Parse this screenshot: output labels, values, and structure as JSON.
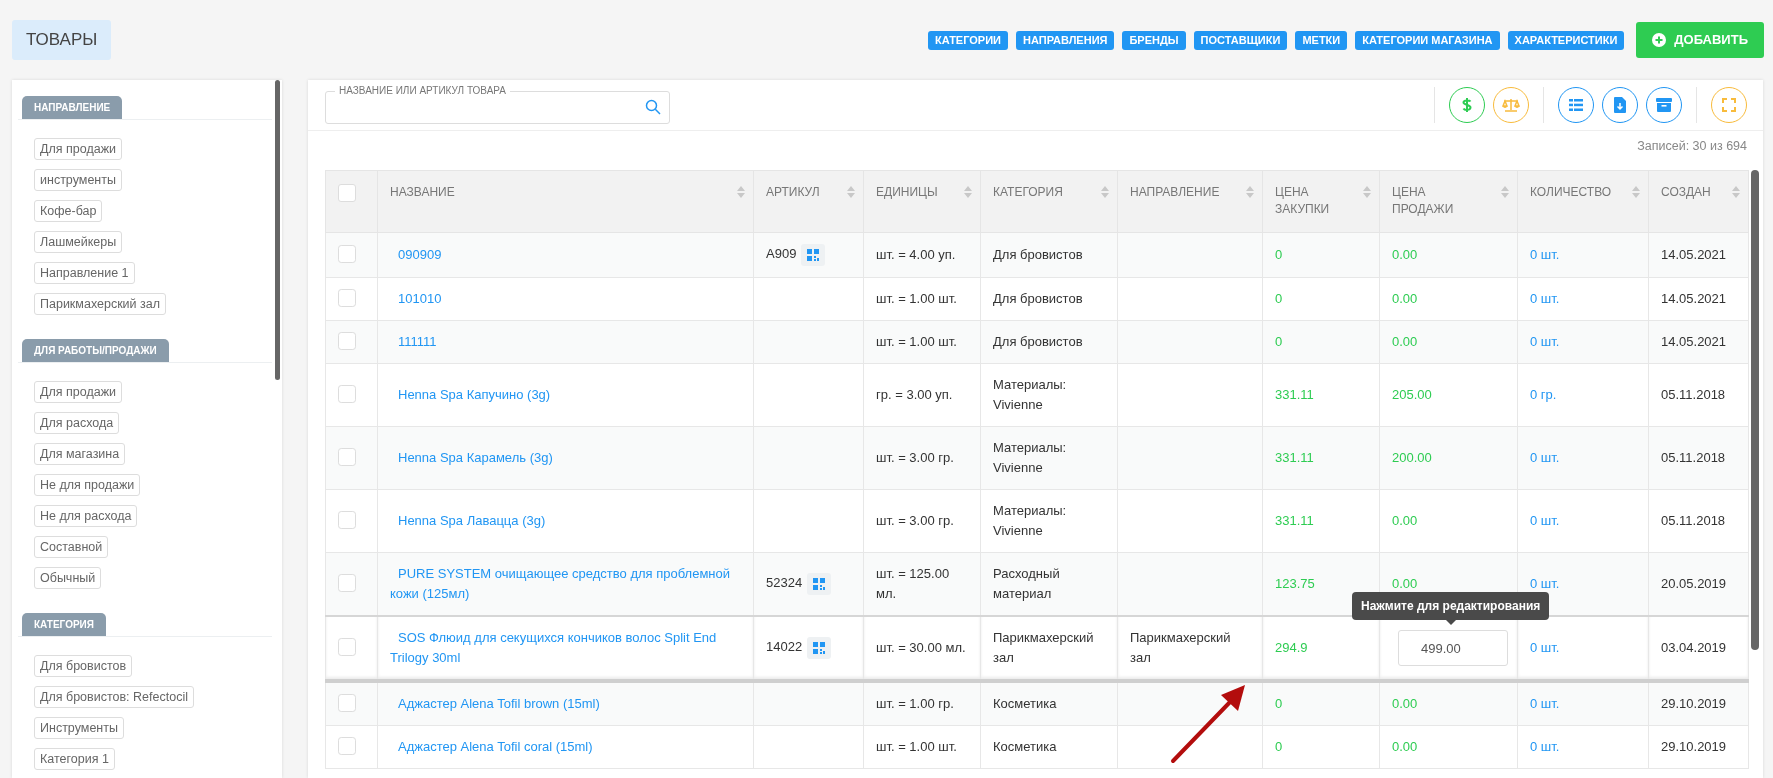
{
  "page": {
    "title": "ТОВАРЫ"
  },
  "header_buttons": [
    "КАТЕГОРИИ",
    "НАПРАВЛЕНИЯ",
    "БРЕНДЫ",
    "ПОСТАВЩИКИ",
    "МЕТКИ",
    "КАТЕГОРИИ МАГАЗИНА",
    "ХАРАКТЕРИСТИКИ"
  ],
  "add_button": {
    "label": "ДОБАВИТЬ"
  },
  "sidebar": {
    "sections": [
      {
        "title": "НАПРАВЛЕНИЕ",
        "items": [
          "Для продажи",
          "инструменты",
          "Кофе-бар",
          "Лашмейкеры",
          "Направление 1",
          "Парикмахерский зал"
        ]
      },
      {
        "title": "ДЛЯ РАБОТЫ/ПРОДАЖИ",
        "items": [
          "Для продажи",
          "Для расхода",
          "Для магазина",
          "Не для продажи",
          "Не для расхода",
          "Составной",
          "Обычный"
        ]
      },
      {
        "title": "КАТЕГОРИЯ",
        "items": [
          "Для бровистов",
          "Для бровистов: Refectocil",
          "Инструменты",
          "Категория 1"
        ]
      }
    ]
  },
  "search": {
    "label": "НАЗВАНИЕ ИЛИ АРТИКУЛ ТОВАРА"
  },
  "records": "Записей: 30 из 694",
  "table": {
    "select_all": {
      "checked": false
    },
    "columns": [
      "НАЗВАНИЕ",
      "АРТИКУЛ",
      "ЕДИНИЦЫ",
      "КАТЕГОРИЯ",
      "НАПРАВЛЕНИЕ",
      "ЦЕНА ЗАКУПКИ",
      "ЦЕНА ПРОДАЖИ",
      "КОЛИЧЕСТВО",
      "СОЗДАН"
    ],
    "rows": [
      {
        "checked": false,
        "highlighted": false,
        "editing": false,
        "name": "090909",
        "article": "A909",
        "units": "шт. = 4.00 уп.",
        "category": "Для бровистов",
        "purchase_price": "0",
        "sale_price": "0.00",
        "quantity": "0 шт.",
        "created": "14.05.2021"
      },
      {
        "checked": false,
        "highlighted": false,
        "editing": false,
        "name": "101010",
        "units": "шт. = 1.00 шт.",
        "category": "Для бровистов",
        "purchase_price": "0",
        "sale_price": "0.00",
        "quantity": "0 шт.",
        "created": "14.05.2021"
      },
      {
        "checked": false,
        "highlighted": false,
        "editing": false,
        "name": "111111",
        "units": "шт. = 1.00 шт.",
        "category": "Для бровистов",
        "purchase_price": "0",
        "sale_price": "0.00",
        "quantity": "0 шт.",
        "created": "14.05.2021"
      },
      {
        "checked": false,
        "highlighted": false,
        "editing": false,
        "name": "Henna Spa Капучино (3g)",
        "units": "гр. = 3.00 уп.",
        "category": "Материалы: Vivienne",
        "purchase_price": "331.11",
        "sale_price": "205.00",
        "quantity": "0 гр.",
        "created": "05.11.2018"
      },
      {
        "checked": false,
        "highlighted": false,
        "editing": false,
        "name": "Henna Spa Карамель (3g)",
        "units": "шт. = 3.00 гр.",
        "category": "Материалы: Vivienne",
        "purchase_price": "331.11",
        "sale_price": "200.00",
        "quantity": "0 шт.",
        "created": "05.11.2018"
      },
      {
        "checked": false,
        "highlighted": false,
        "editing": false,
        "name": "Henna Spa Лавацца (3g)",
        "units": "шт. = 3.00 гр.",
        "category": "Материалы: Vivienne",
        "purchase_price": "331.11",
        "sale_price": "0.00",
        "quantity": "0 шт.",
        "created": "05.11.2018"
      },
      {
        "checked": false,
        "highlighted": false,
        "editing": false,
        "name": "PURE SYSTEM очищающее средство для проблемной кожи (125мл)",
        "article": "52324",
        "units": "шт. = 125.00 мл.",
        "category": "Расходный материал",
        "purchase_price": "123.75",
        "sale_price": "0.00",
        "quantity": "0 шт.",
        "created": "20.05.2019"
      },
      {
        "checked": false,
        "highlighted": true,
        "editing": true,
        "tooltip": "Нажмите для редактирования",
        "name": "SOS Флюид для секущихся кончиков волос Split End Trilogy 30ml",
        "article": "14022",
        "units": "шт. = 30.00 мл.",
        "category": "Парикмахерский зал",
        "direction": "Парикмахерский зал",
        "purchase_price": "294.9",
        "sale_price": "499.00",
        "quantity": "0 шт.",
        "created": "03.04.2019"
      },
      {
        "checked": false,
        "highlighted": false,
        "editing": false,
        "name": "Аджастер Alena Tofil brown (15ml)",
        "units": "шт. = 1.00 гр.",
        "category": "Косметика",
        "purchase_price": "0",
        "sale_price": "0.00",
        "quantity": "0 шт.",
        "created": "29.10.2019"
      },
      {
        "checked": false,
        "highlighted": false,
        "editing": false,
        "name": "Аджастер Alena Tofil coral (15ml)",
        "units": "шт. = 1.00 шт.",
        "category": "Косметика",
        "purchase_price": "0",
        "sale_price": "0.00",
        "quantity": "0 шт.",
        "created": "29.10.2019"
      }
    ]
  }
}
